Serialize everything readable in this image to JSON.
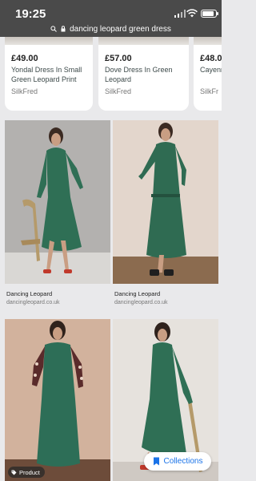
{
  "status_bar": {
    "time": "19:25",
    "url": "dancing leopard green dress",
    "battery_level": 0.85
  },
  "products": [
    {
      "price": "£49.00",
      "name": "Yondal Dress In Small Green Leopard Print",
      "seller": "SilkFred"
    },
    {
      "price": "£57.00",
      "name": "Dove Dress In Green Leopard",
      "seller": "SilkFred"
    },
    {
      "price": "£48.0",
      "name": "Cayenn Leopar",
      "seller": "SilkFr"
    }
  ],
  "results": [
    {
      "title": "Dancing Leopard",
      "source": "dancingleopard.co.uk"
    },
    {
      "title": "Dancing Leopard",
      "source": "dancingleopard.co.uk"
    }
  ],
  "badge": {
    "label": "Product",
    "icon": "tag-icon"
  },
  "collections": {
    "label": "Collections",
    "icon": "bookmark-icon",
    "color": "#1a73e8"
  }
}
